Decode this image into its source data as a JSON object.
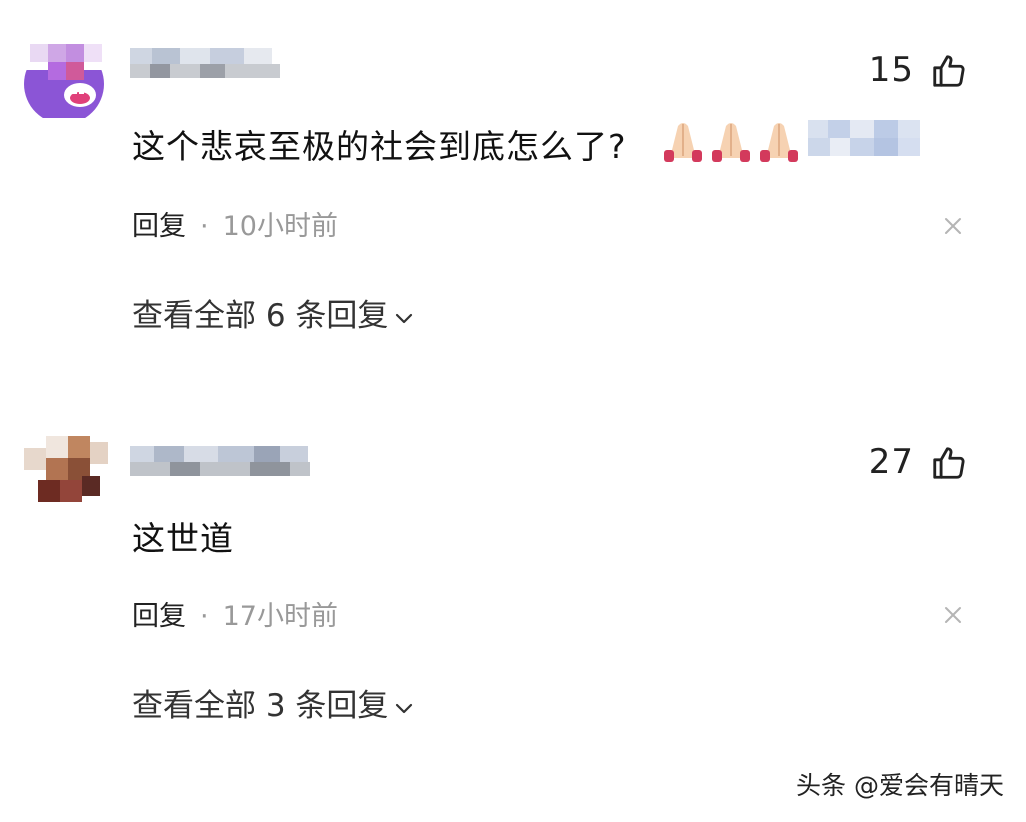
{
  "comments": [
    {
      "username": "",
      "like_count": "15",
      "text": "这个悲哀至极的社会到底怎么了?",
      "emoji_names": [
        "folded-hands-icon",
        "folded-hands-icon",
        "folded-hands-icon"
      ],
      "reply_label": "回复",
      "separator": "·",
      "time": "10小时前",
      "view_replies": "查看全部 6 条回复"
    },
    {
      "username": "",
      "like_count": "27",
      "text": "这世道",
      "reply_label": "回复",
      "separator": "·",
      "time": "17小时前",
      "view_replies": "查看全部 3 条回复"
    }
  ],
  "watermark": "头条 @爱会有晴天",
  "colors": {
    "text": "#111111",
    "muted": "#999999",
    "blur_blue": "#c9d6ec",
    "avatar1_purple": "#7a45c8",
    "avatar2_brown": "#8a5a3a"
  }
}
